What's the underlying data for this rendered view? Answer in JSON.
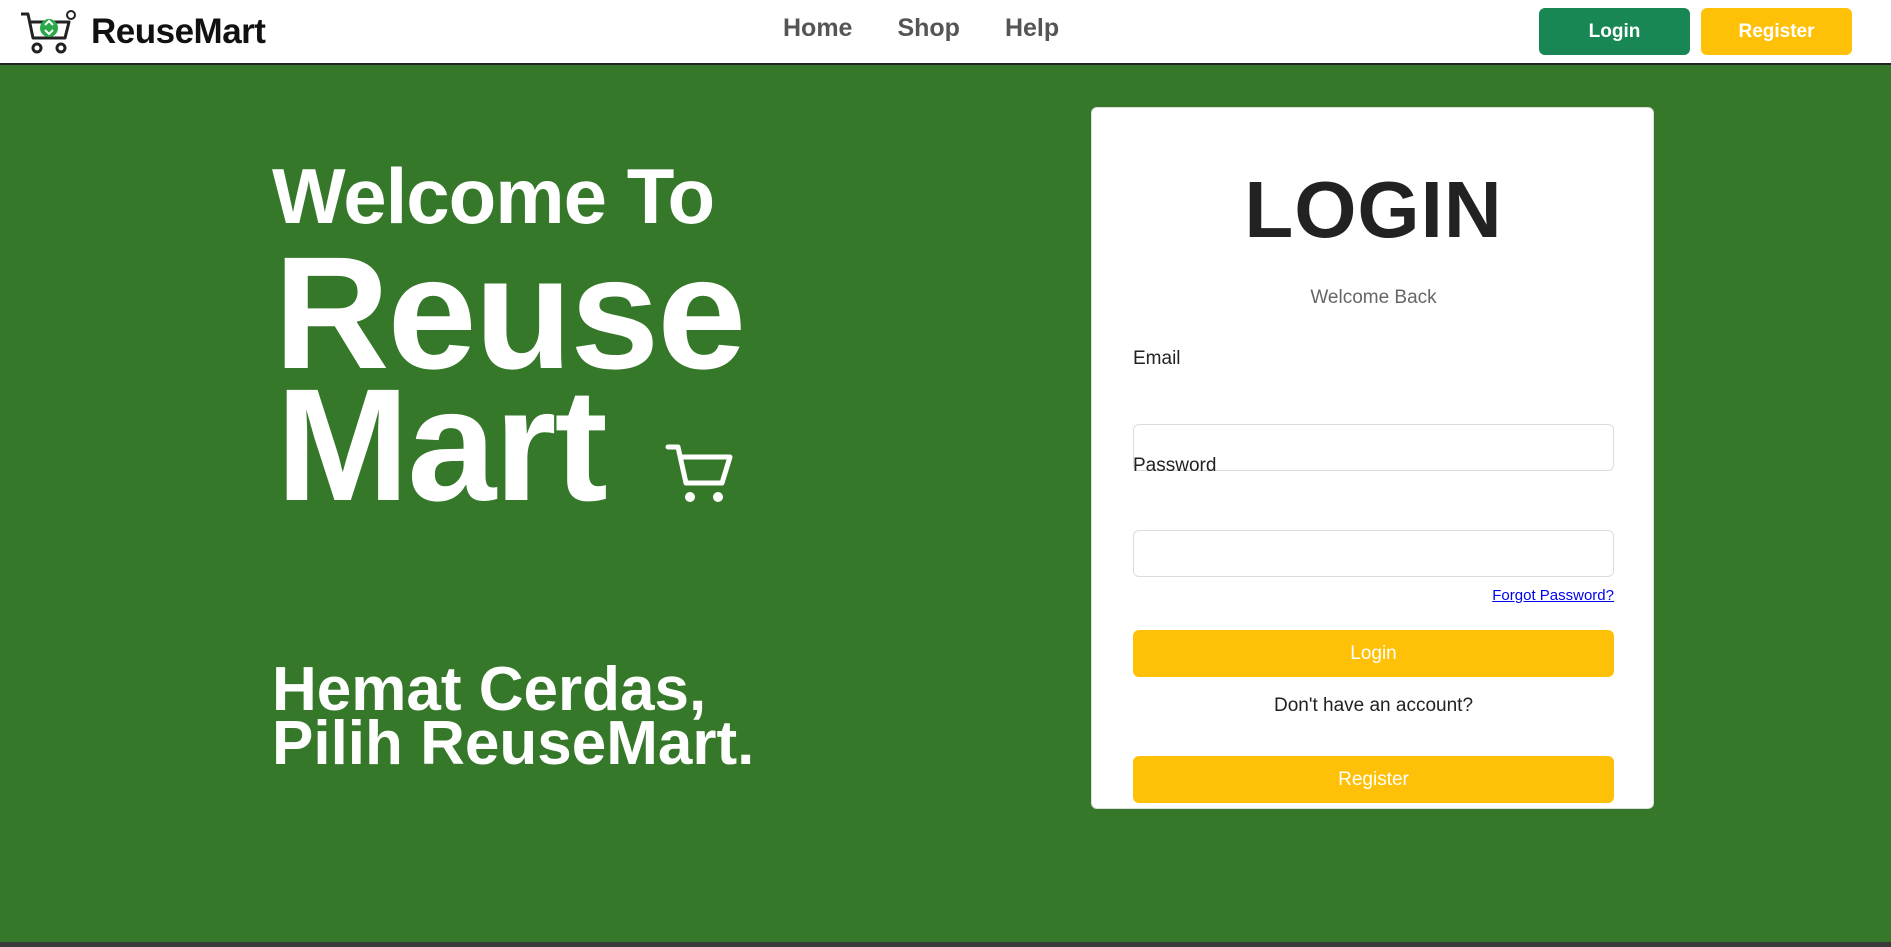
{
  "navbar": {
    "brand_name": "ReuseMart",
    "logo_icon": "recycle-cart-logo",
    "links": [
      "Home",
      "Shop",
      "Help"
    ],
    "login_label": "Login",
    "register_label": "Register",
    "login_color": "#198754",
    "register_color": "#ffc107"
  },
  "hero": {
    "background_color": "#35782a",
    "welcome_to": "Welcome To",
    "reuse": "Reuse",
    "mart": "Mart",
    "cart_icon": "cart-icon",
    "tagline_line1": "Hemat Cerdas,",
    "tagline_line2": "Pilih ReuseMart."
  },
  "login_card": {
    "title": "LOGIN",
    "subtitle": "Welcome Back",
    "email_label": "Email",
    "email_value": "",
    "password_label": "Password",
    "password_value": "",
    "forgot_password": "Forgot Password?",
    "login_button": "Login",
    "no_account_text": "Don't have an account?",
    "register_button": "Register",
    "button_color": "#ffc107"
  }
}
